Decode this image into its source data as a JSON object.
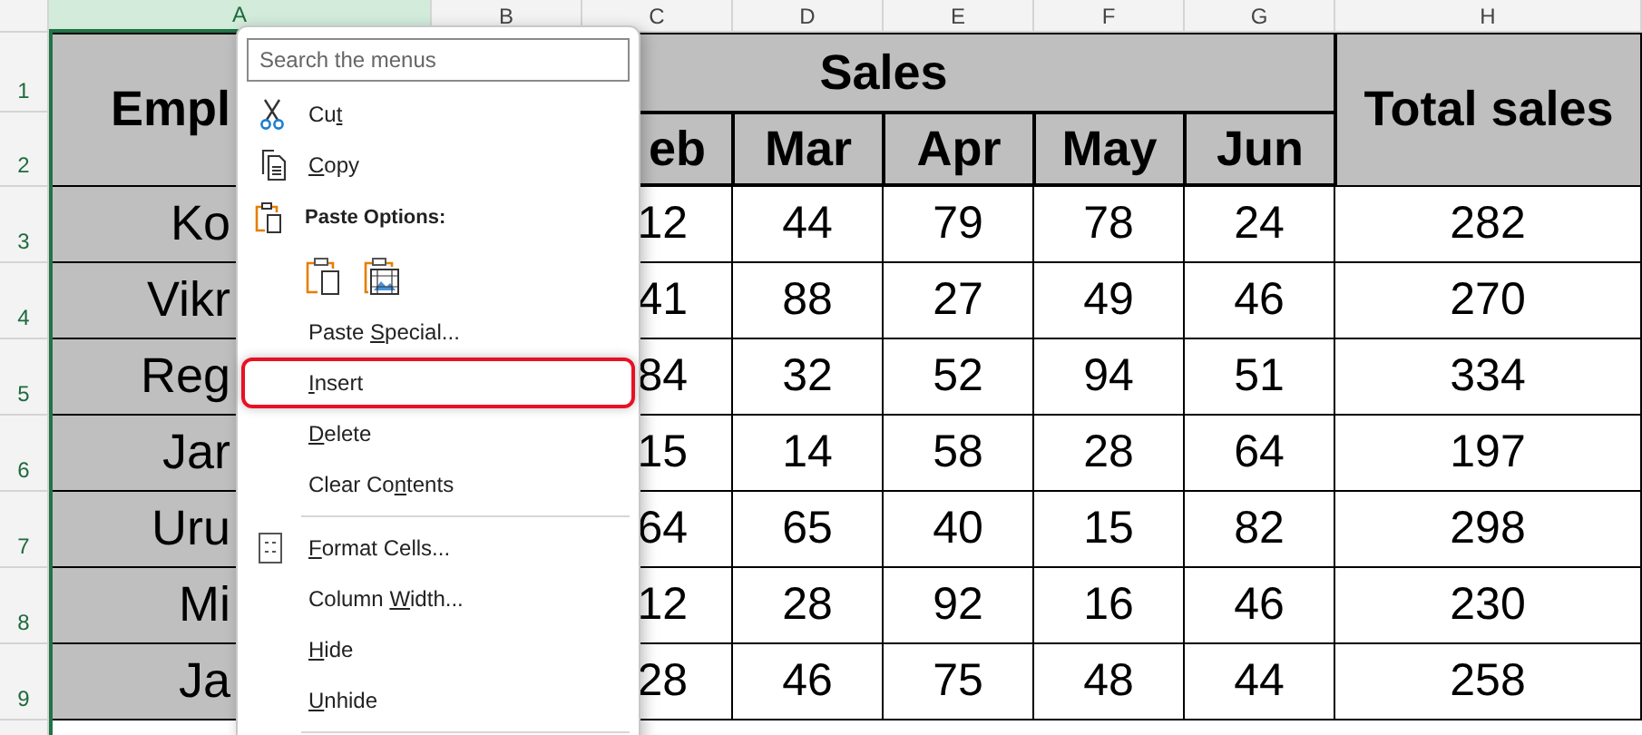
{
  "columns": [
    {
      "label": "A",
      "selected": true
    },
    {
      "label": "B",
      "selected": false
    },
    {
      "label": "C",
      "selected": false
    },
    {
      "label": "D",
      "selected": false
    },
    {
      "label": "E",
      "selected": false
    },
    {
      "label": "F",
      "selected": false
    },
    {
      "label": "G",
      "selected": false
    },
    {
      "label": "H",
      "selected": false
    }
  ],
  "row_numbers": [
    "1",
    "2",
    "3",
    "4",
    "5",
    "6",
    "7",
    "8",
    "9"
  ],
  "table": {
    "employee_header": "Empl",
    "sales_header": "Sales",
    "total_header": "Total sales",
    "months": [
      "eb",
      "Mar",
      "Apr",
      "May",
      "Jun"
    ],
    "rows": [
      {
        "name": "Ko",
        "values": [
          "12",
          "44",
          "79",
          "78",
          "24"
        ],
        "total": "282"
      },
      {
        "name": "Vikr",
        "values": [
          "41",
          "88",
          "27",
          "49",
          "46"
        ],
        "total": "270"
      },
      {
        "name": "Reg",
        "values": [
          "84",
          "32",
          "52",
          "94",
          "51"
        ],
        "total": "334"
      },
      {
        "name": "Jar",
        "values": [
          "15",
          "14",
          "58",
          "28",
          "64"
        ],
        "total": "197"
      },
      {
        "name": "Uru",
        "values": [
          "64",
          "65",
          "40",
          "15",
          "82"
        ],
        "total": "298"
      },
      {
        "name": "Mi",
        "values": [
          "12",
          "28",
          "92",
          "16",
          "46"
        ],
        "total": "230"
      },
      {
        "name": "Ja",
        "values": [
          "28",
          "46",
          "75",
          "48",
          "44"
        ],
        "total": "258"
      }
    ]
  },
  "context_menu": {
    "search": {
      "placeholder": "Search the menus"
    },
    "items": [
      {
        "kind": "item",
        "before": "Cu",
        "key": "t",
        "highlighted": false
      },
      {
        "kind": "item",
        "key": "C",
        "after": "opy",
        "highlighted": false
      },
      {
        "kind": "header",
        "label": "Paste Options:"
      },
      {
        "kind": "paste_icons"
      },
      {
        "kind": "item",
        "before": "Paste ",
        "key": "S",
        "after": "pecial...",
        "highlighted": false
      },
      {
        "kind": "item",
        "key": "I",
        "after": "nsert",
        "highlighted": true
      },
      {
        "kind": "item",
        "key": "D",
        "after": "elete",
        "highlighted": false
      },
      {
        "kind": "item",
        "before": "Clear Co",
        "key": "n",
        "after": "tents",
        "highlighted": false
      },
      {
        "kind": "separator"
      },
      {
        "kind": "item",
        "key": "F",
        "after": "ormat Cells...",
        "highlighted": false
      },
      {
        "kind": "item",
        "before": "Column ",
        "key": "W",
        "after": "idth...",
        "highlighted": false
      },
      {
        "kind": "item",
        "key": "H",
        "after": "ide",
        "highlighted": false
      },
      {
        "kind": "item",
        "key": "U",
        "after": "nhide",
        "highlighted": false
      },
      {
        "kind": "separator"
      }
    ]
  }
}
